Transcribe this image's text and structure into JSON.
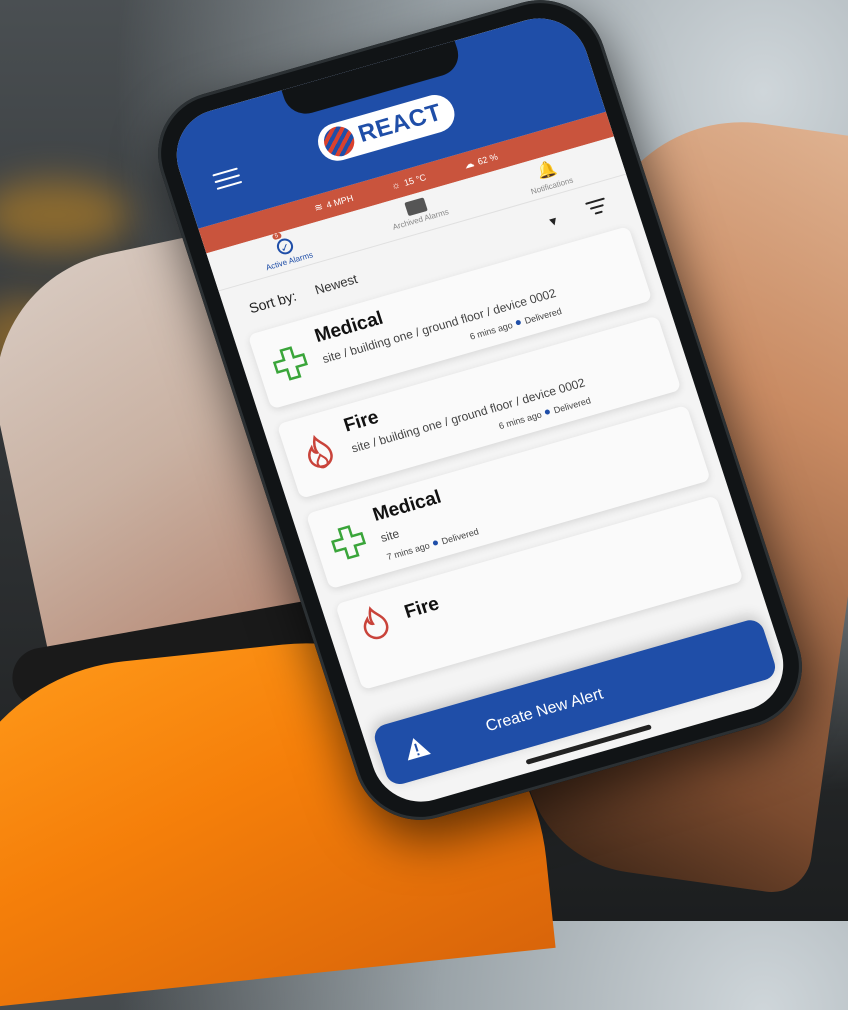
{
  "app": {
    "logo_text": "REACT"
  },
  "weather": [
    {
      "icon": "wind-icon",
      "label": "4 MPH"
    },
    {
      "icon": "thermometer-icon",
      "label": "15 °C"
    },
    {
      "icon": "cloud-icon",
      "label": "62 %"
    }
  ],
  "tabs": [
    {
      "label": "Active Alarms",
      "icon": "checklist-icon",
      "active": true,
      "badge": "5"
    },
    {
      "label": "Archived Alarms",
      "icon": "archive-icon",
      "active": false
    },
    {
      "label": "Notifications",
      "icon": "bell-icon",
      "active": false
    }
  ],
  "sort": {
    "label": "Sort by:",
    "value": "Newest"
  },
  "alerts": [
    {
      "title": "Medical",
      "type": "medical",
      "path": "site / building one / ground floor / device 0002",
      "time": "6 mins ago",
      "status": "Delivered"
    },
    {
      "title": "Fire",
      "type": "fire",
      "path": "site / building one / ground floor / device 0002",
      "time": "6 mins ago",
      "status": "Delivered"
    },
    {
      "title": "Medical",
      "type": "medical",
      "path": "site",
      "time": "7 mins ago",
      "status": "Delivered"
    },
    {
      "title": "Fire",
      "type": "fire",
      "path": "",
      "time": "",
      "status": ""
    }
  ],
  "create_button": {
    "label": "Create New Alert"
  },
  "colors": {
    "brand_blue": "#1f4ea8",
    "accent_red": "#c9543d",
    "medical_green": "#3aa53a",
    "fire_red": "#c9433a"
  }
}
